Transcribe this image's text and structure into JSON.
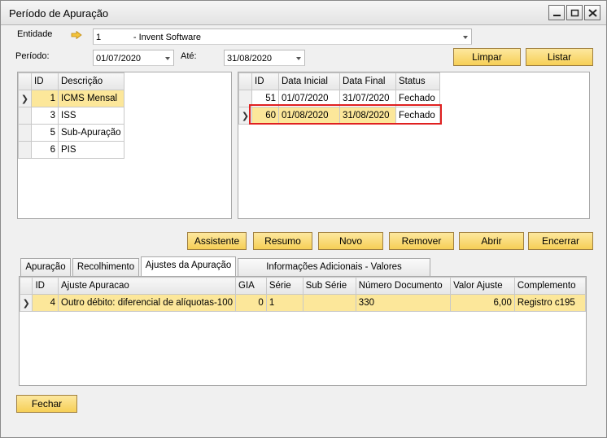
{
  "window": {
    "title": "Período de Apuração"
  },
  "filters": {
    "entidade_label": "Entidade",
    "entidade_value": "1             - Invent Software",
    "periodo_label": "Período:",
    "periodo_value": "01/07/2020",
    "ate_label": "Até:",
    "ate_value": "31/08/2020"
  },
  "top_buttons": {
    "limpar": "Limpar",
    "listar": "Listar"
  },
  "left_grid": {
    "headers": [
      "ID",
      "Descrição"
    ],
    "rows": [
      {
        "id": "1",
        "descricao": "ICMS Mensal"
      },
      {
        "id": "3",
        "descricao": "ISS"
      },
      {
        "id": "5",
        "descricao": "Sub-Apuração"
      },
      {
        "id": "6",
        "descricao": "PIS"
      }
    ]
  },
  "right_grid": {
    "headers": [
      "ID",
      "Data Inicial",
      "Data Final",
      "Status"
    ],
    "rows": [
      {
        "id": "51",
        "inicial": "01/07/2020",
        "final": "31/07/2020",
        "status": "Fechado"
      },
      {
        "id": "60",
        "inicial": "01/08/2020",
        "final": "31/08/2020",
        "status": "Fechado"
      }
    ]
  },
  "action_buttons": {
    "assistente": "Assistente",
    "resumo": "Resumo",
    "novo": "Novo",
    "remover": "Remover",
    "abrir": "Abrir",
    "encerrar": "Encerrar"
  },
  "tabs": [
    "Apuração",
    "Recolhimento",
    "Ajustes da Apuração",
    "Informações Adicionais - Valores Declaratórios"
  ],
  "bottom_grid": {
    "headers": [
      "ID",
      "Ajuste Apuracao",
      "GIA",
      "Série",
      "Sub Série",
      "Número Documento",
      "Valor Ajuste",
      "Complemento"
    ],
    "row": {
      "id": "4",
      "ajuste": "Outro débito: diferencial de alíquotas-100",
      "gia": "0",
      "serie": "1",
      "subserie": "",
      "numero": "330",
      "valor": "6,00",
      "complemento": "Registro c195"
    }
  },
  "footer": {
    "fechar": "Fechar"
  },
  "colors": {
    "selection": "#fce79a",
    "button": "#f6cf56",
    "highlight": "#e02020"
  }
}
